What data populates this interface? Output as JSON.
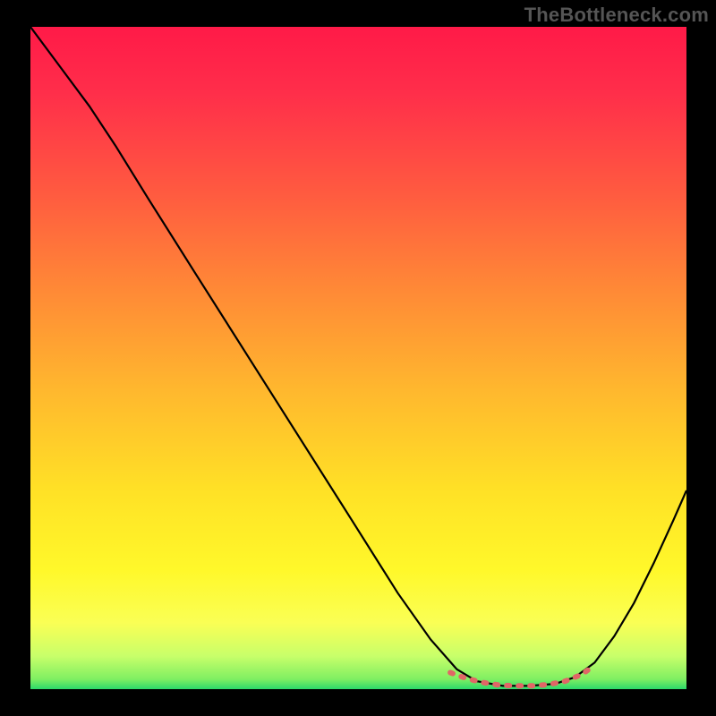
{
  "watermark": "TheBottleneck.com",
  "chart_data": {
    "type": "line",
    "title": "",
    "xlabel": "",
    "ylabel": "",
    "xlim": [
      0,
      100
    ],
    "ylim": [
      0,
      100
    ],
    "background_gradient_stops": [
      {
        "offset": 0.0,
        "color": "#ff1a48"
      },
      {
        "offset": 0.1,
        "color": "#ff2e4a"
      },
      {
        "offset": 0.25,
        "color": "#ff5a40"
      },
      {
        "offset": 0.4,
        "color": "#ff8a36"
      },
      {
        "offset": 0.55,
        "color": "#ffb82e"
      },
      {
        "offset": 0.7,
        "color": "#ffe126"
      },
      {
        "offset": 0.82,
        "color": "#fff82a"
      },
      {
        "offset": 0.9,
        "color": "#faff55"
      },
      {
        "offset": 0.95,
        "color": "#c8ff6a"
      },
      {
        "offset": 0.985,
        "color": "#7fef62"
      },
      {
        "offset": 1.0,
        "color": "#2bd96a"
      }
    ],
    "series": [
      {
        "name": "bottleneck-curve",
        "color": "#000000",
        "width": 2.2,
        "points": [
          {
            "x": 0.0,
            "y": 100.0
          },
          {
            "x": 4.5,
            "y": 94.0
          },
          {
            "x": 9.0,
            "y": 88.0
          },
          {
            "x": 13.0,
            "y": 82.0
          },
          {
            "x": 18.0,
            "y": 74.0
          },
          {
            "x": 25.0,
            "y": 63.0
          },
          {
            "x": 33.0,
            "y": 50.5
          },
          {
            "x": 41.0,
            "y": 38.0
          },
          {
            "x": 49.0,
            "y": 25.5
          },
          {
            "x": 56.0,
            "y": 14.5
          },
          {
            "x": 61.0,
            "y": 7.5
          },
          {
            "x": 65.0,
            "y": 3.0
          },
          {
            "x": 68.0,
            "y": 1.2
          },
          {
            "x": 72.0,
            "y": 0.5
          },
          {
            "x": 76.0,
            "y": 0.5
          },
          {
            "x": 80.0,
            "y": 0.8
          },
          {
            "x": 83.0,
            "y": 1.8
          },
          {
            "x": 86.0,
            "y": 4.0
          },
          {
            "x": 89.0,
            "y": 8.0
          },
          {
            "x": 92.0,
            "y": 13.0
          },
          {
            "x": 95.0,
            "y": 19.0
          },
          {
            "x": 98.0,
            "y": 25.5
          },
          {
            "x": 100.0,
            "y": 30.0
          }
        ]
      },
      {
        "name": "optimal-range-marker",
        "color": "#e06666",
        "width": 6,
        "dash": "3 10",
        "points": [
          {
            "x": 64.0,
            "y": 2.5
          },
          {
            "x": 66.5,
            "y": 1.6
          },
          {
            "x": 69.0,
            "y": 1.0
          },
          {
            "x": 71.5,
            "y": 0.6
          },
          {
            "x": 74.0,
            "y": 0.5
          },
          {
            "x": 76.5,
            "y": 0.5
          },
          {
            "x": 79.0,
            "y": 0.7
          },
          {
            "x": 81.5,
            "y": 1.2
          },
          {
            "x": 84.0,
            "y": 2.2
          },
          {
            "x": 86.0,
            "y": 3.6
          }
        ]
      }
    ]
  }
}
